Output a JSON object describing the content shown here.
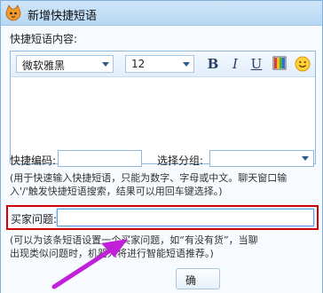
{
  "window": {
    "title": "新增快捷短语"
  },
  "form": {
    "content_label": "快捷短语内容:",
    "font_family": "微软雅黑",
    "font_size": "12",
    "bold_label": "B",
    "italic_label": "I",
    "underline_label": "U",
    "shortcut_code_label": "快捷编码:",
    "group_label": "选择分组:",
    "hint_line1": "(用于快速输入快捷短语，只能为数字、字母或中文。聊天窗口输",
    "hint_line2": "入'/'触发快捷短语搜索，结果可以用回车键选择。)",
    "buyer_question_label": "买家问题:",
    "buyer_hint_line1": "(可以为该条短语设置一个买家问题，如“有没有货”，当聊",
    "buyer_hint_line2": "出现类似问题时，机器人将进行智能短语推荐。)",
    "bottom_button_label": "确"
  },
  "colors": {
    "title_bar": "#b7d8f4",
    "border": "#8fb8dc",
    "highlight": "#d40000",
    "annotation_arrow": "#c020d8"
  },
  "icons": {
    "app": "cat-logo-icon",
    "color": "color-palette-icon",
    "emoji": "smiley-icon"
  }
}
